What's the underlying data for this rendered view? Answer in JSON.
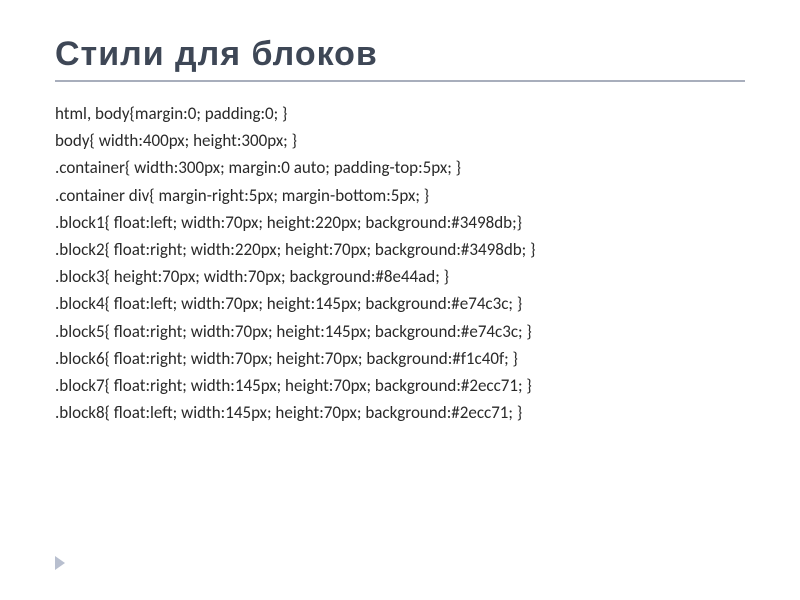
{
  "title": "Стили для блоков",
  "code": {
    "l0": "html, body{margin:0; padding:0; }",
    "l1": "body{ width:400px; height:300px; }",
    "l2": ".container{ width:300px; margin:0 auto; padding-top:5px; }",
    "l3": ".container div{ margin-right:5px; margin-bottom:5px; }",
    "l4": ".block1{ float:left; width:70px; height:220px; background:#3498db;}",
    "l5": ".block2{ float:right; width:220px; height:70px; background:#3498db; }",
    "l6": ".block3{ height:70px; width:70px; background:#8e44ad; }",
    "l7": ".block4{ float:left; width:70px; height:145px; background:#e74c3c; }",
    "l8": ".block5{ float:right; width:70px; height:145px; background:#e74c3c; }",
    "l9": ".block6{ float:right; width:70px; height:70px; background:#f1c40f; }",
    "l10": ".block7{ float:right; width:145px; height:70px; background:#2ecc71; }",
    "l11": ".block8{ float:left; width:145px; height:70px; background:#2ecc71; }"
  }
}
